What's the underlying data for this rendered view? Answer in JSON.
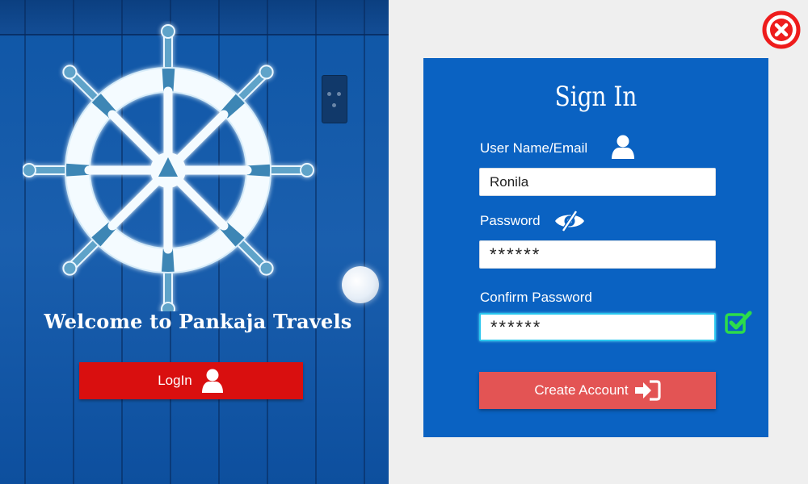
{
  "welcome": {
    "heading": "Welcome to Pankaja Travels",
    "login_label": "LogIn"
  },
  "signin": {
    "title": "Sign In",
    "username_label": "User Name/Email",
    "username_value": "Ronila",
    "password_label": "Password",
    "password_value": "******",
    "confirm_label": "Confirm Password",
    "confirm_value": "******",
    "create_label": "Create Account"
  },
  "icons": {
    "close": "close-circle-icon",
    "user": "user-icon",
    "password_toggle": "eye-slash-icon",
    "match": "check-square-icon",
    "create": "sign-in-icon",
    "login": "user-icon"
  },
  "colors": {
    "card": "#0a62c2",
    "login_button": "#d90f0f",
    "create_button": "#e35454",
    "close": "#ee1c1c",
    "check": "#2ddc4a",
    "focus": "#29c6ee"
  }
}
